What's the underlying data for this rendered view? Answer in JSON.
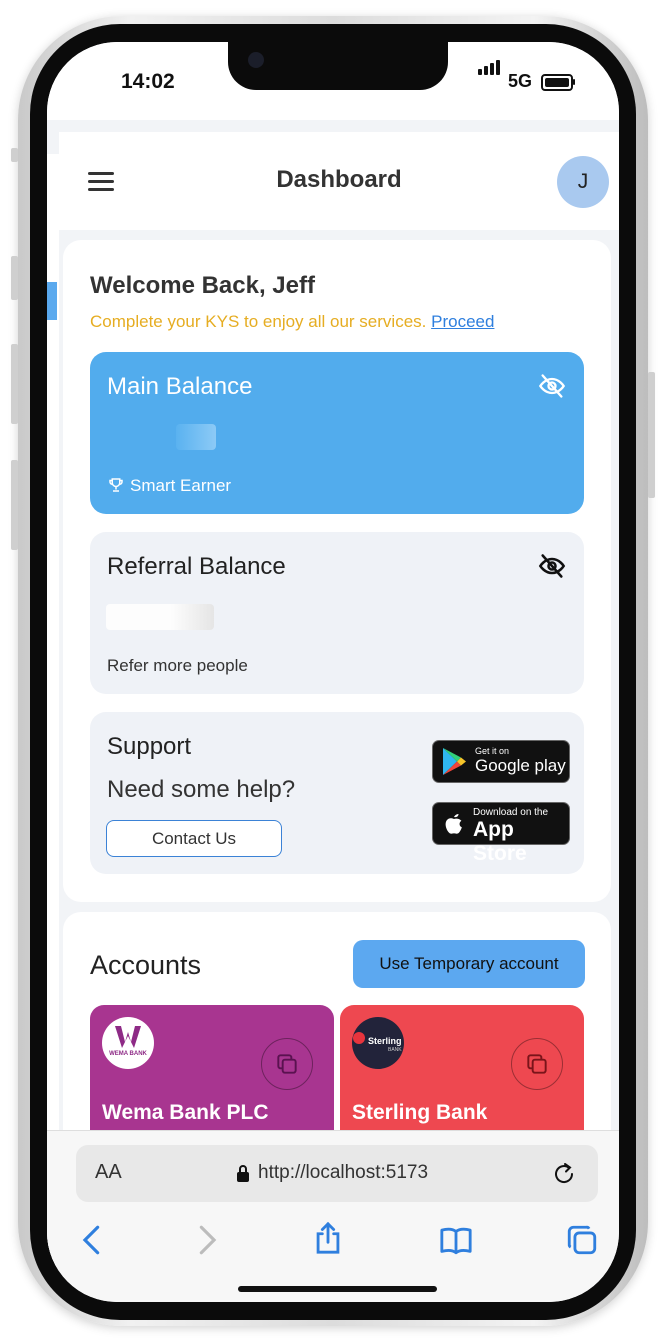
{
  "status_bar": {
    "time": "14:02",
    "network": "5G"
  },
  "header": {
    "title": "Dashboard",
    "avatar_initial": "J"
  },
  "welcome": {
    "heading": "Welcome Back, Jeff",
    "kys_message": "Complete your KYS to enjoy all our services.",
    "kys_link": "Proceed"
  },
  "main_balance": {
    "title": "Main Balance",
    "tier": "Smart Earner"
  },
  "referral_balance": {
    "title": "Referral Balance",
    "subtitle": "Refer more people"
  },
  "support": {
    "title": "Support",
    "prompt": "Need some help?",
    "contact_button": "Contact Us",
    "google_play": {
      "top": "Get it on",
      "name": "Google play"
    },
    "app_store": {
      "top": "Download on the",
      "name": "App Store"
    }
  },
  "accounts": {
    "title": "Accounts",
    "temp_button": "Use Temporary account",
    "banks": [
      {
        "name": "Wema Bank PLC",
        "logo_text": "WEMA BANK",
        "color": "#a83590"
      },
      {
        "name": "Sterling Bank",
        "logo_text": "Sterling",
        "logo_sub": "BANK",
        "color": "#ee4850"
      }
    ]
  },
  "browser": {
    "text_size": "AA",
    "url": "http://localhost:5173"
  },
  "colors": {
    "primary": "#52aced",
    "card_gray": "#eff2f7",
    "warning": "#e6ad22",
    "link": "#2f7fde"
  }
}
